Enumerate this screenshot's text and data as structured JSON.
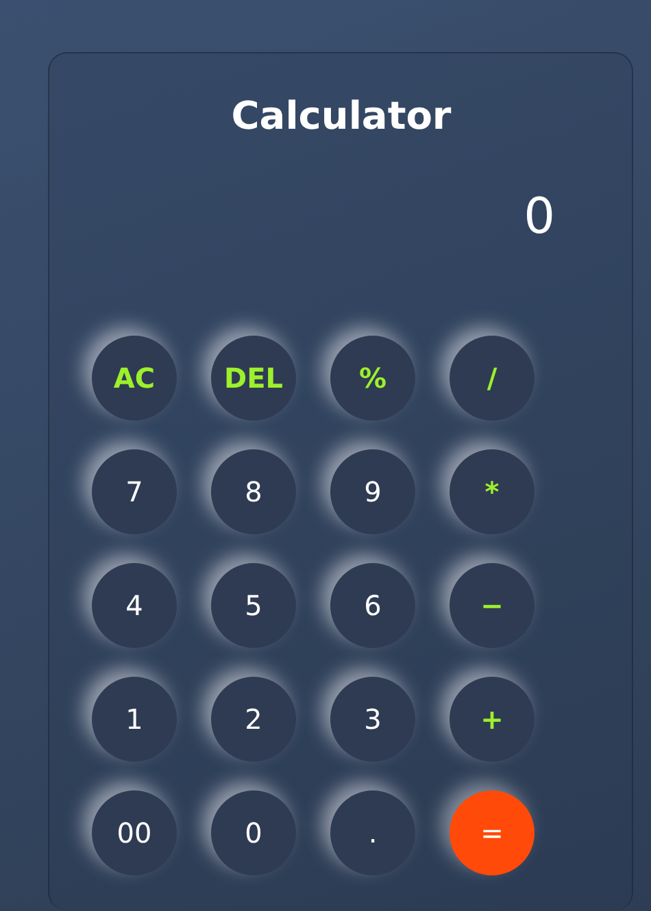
{
  "title": "Calculator",
  "display": {
    "value": "0"
  },
  "keys": [
    {
      "label": "AC",
      "kind": "operator"
    },
    {
      "label": "DEL",
      "kind": "operator"
    },
    {
      "label": "%",
      "kind": "operator"
    },
    {
      "label": "/",
      "kind": "operator"
    },
    {
      "label": "7",
      "kind": "digit"
    },
    {
      "label": "8",
      "kind": "digit"
    },
    {
      "label": "9",
      "kind": "digit"
    },
    {
      "label": "*",
      "kind": "operator"
    },
    {
      "label": "4",
      "kind": "digit"
    },
    {
      "label": "5",
      "kind": "digit"
    },
    {
      "label": "6",
      "kind": "digit"
    },
    {
      "label": "−",
      "kind": "operator"
    },
    {
      "label": "1",
      "kind": "digit"
    },
    {
      "label": "2",
      "kind": "digit"
    },
    {
      "label": "3",
      "kind": "digit"
    },
    {
      "label": "+",
      "kind": "operator"
    },
    {
      "label": "00",
      "kind": "digit"
    },
    {
      "label": "0",
      "kind": "digit"
    },
    {
      "label": ".",
      "kind": "digit"
    },
    {
      "label": "=",
      "kind": "equals"
    }
  ]
}
